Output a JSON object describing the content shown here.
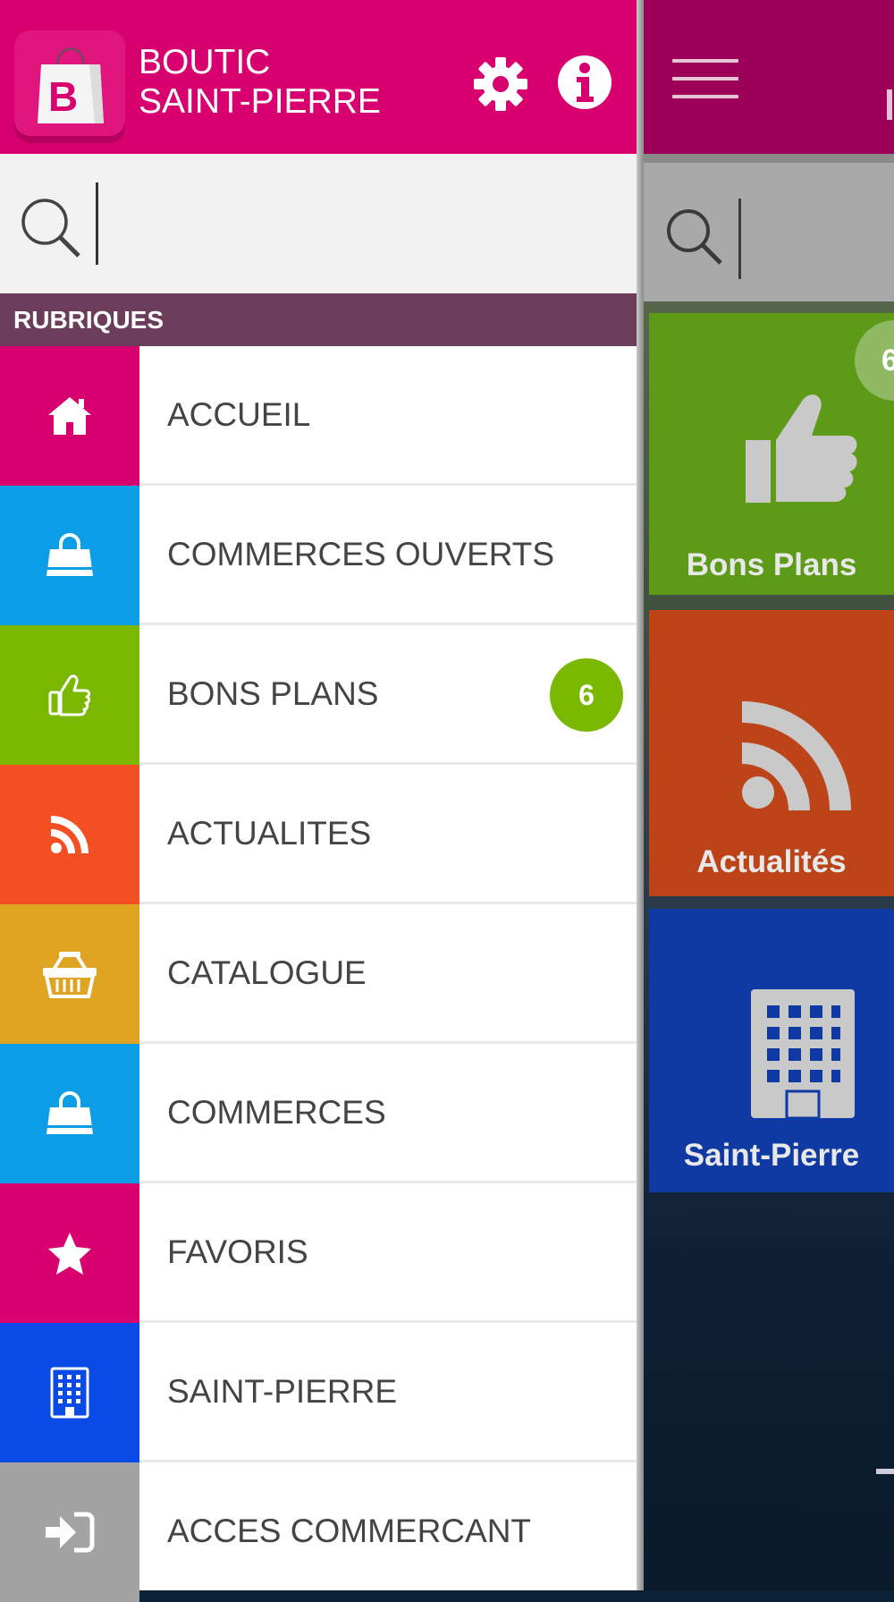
{
  "app": {
    "title_line1": "BOUTIC",
    "title_line2": "SAINT-PIERRE"
  },
  "search": {
    "placeholder": ""
  },
  "section": {
    "title": "RUBRIQUES"
  },
  "menu": [
    {
      "label": "ACCUEIL",
      "icon": "home-icon",
      "color": "#d8006e"
    },
    {
      "label": "COMMERCES OUVERTS",
      "icon": "shopping-bag-icon",
      "color": "#0b9ee6"
    },
    {
      "label": "BONS PLANS",
      "icon": "thumbs-up-icon",
      "color": "#7ab800",
      "badge": "6"
    },
    {
      "label": "ACTUALITES",
      "icon": "rss-icon",
      "color": "#f25022"
    },
    {
      "label": "CATALOGUE",
      "icon": "basket-icon",
      "color": "#dea422"
    },
    {
      "label": "COMMERCES",
      "icon": "shopping-bag-icon",
      "color": "#0b9ee6"
    },
    {
      "label": "FAVORIS",
      "icon": "star-icon",
      "color": "#d8006e"
    },
    {
      "label": "SAINT-PIERRE",
      "icon": "building-icon",
      "color": "#0a4ae6"
    },
    {
      "label": "ACCES COMMERCANT",
      "icon": "sign-in-icon",
      "color": "#a3a3a3"
    }
  ],
  "background": {
    "tiles": [
      {
        "label": "Bons Plans",
        "badge": "6"
      },
      {
        "label": "Actualités"
      },
      {
        "label": "Saint-Pierre"
      }
    ]
  }
}
